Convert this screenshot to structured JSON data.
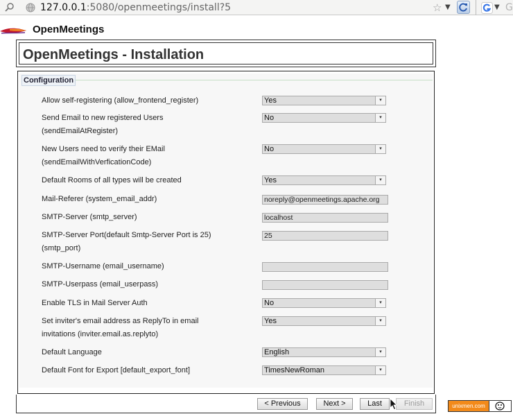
{
  "browser": {
    "url_host": "127.0.0.1",
    "url_rest": ":5080/openmeetings/install?5",
    "search_hint": "G"
  },
  "app": {
    "name": "OpenMeetings",
    "title": "OpenMeetings - Installation"
  },
  "section": {
    "legend": "Configuration"
  },
  "rows": [
    {
      "label_lines": [
        "Allow self-registering (allow_frontend_register)"
      ],
      "control": "select",
      "value": "Yes"
    },
    {
      "label_lines": [
        "Send Email to new registered Users",
        "(sendEmailAtRegister)"
      ],
      "control": "select",
      "value": "No"
    },
    {
      "label_lines": [
        "New Users need to verify their EMail",
        "(sendEmailWithVerficationCode)"
      ],
      "control": "select",
      "value": "No"
    },
    {
      "label_lines": [
        "Default Rooms of all types will be created"
      ],
      "control": "select",
      "value": "Yes"
    },
    {
      "label_lines": [
        "Mail-Referer (system_email_addr)"
      ],
      "control": "text",
      "value": "noreply@openmeetings.apache.org"
    },
    {
      "label_lines": [
        "SMTP-Server (smtp_server)"
      ],
      "control": "text",
      "value": "localhost"
    },
    {
      "label_lines": [
        "SMTP-Server Port(default Smtp-Server Port is 25)",
        "(smtp_port)"
      ],
      "control": "text",
      "value": "25"
    },
    {
      "label_lines": [
        "SMTP-Username (email_username)"
      ],
      "control": "text",
      "value": ""
    },
    {
      "label_lines": [
        "SMTP-Userpass (email_userpass)"
      ],
      "control": "text",
      "value": ""
    },
    {
      "label_lines": [
        "Enable TLS in Mail Server Auth"
      ],
      "control": "select",
      "value": "No"
    },
    {
      "label_lines": [
        "Set inviter's email address as ReplyTo in email",
        "invitations (inviter.email.as.replyto)"
      ],
      "control": "select",
      "value": "Yes"
    },
    {
      "label_lines": [
        "Default Language"
      ],
      "control": "select",
      "value": "English"
    },
    {
      "label_lines": [
        "Default Font for Export [default_export_font]"
      ],
      "control": "select",
      "value": "TimesNewRoman"
    }
  ],
  "nav": {
    "previous": "< Previous",
    "next": "Next >",
    "last": "Last",
    "finish": "Finish"
  },
  "badge": {
    "text": "unixmen.com"
  },
  "colors": {
    "badge_orange": "#f28a1a",
    "field_gray": "#dedede",
    "panel_bg": "#f7f7f7"
  }
}
